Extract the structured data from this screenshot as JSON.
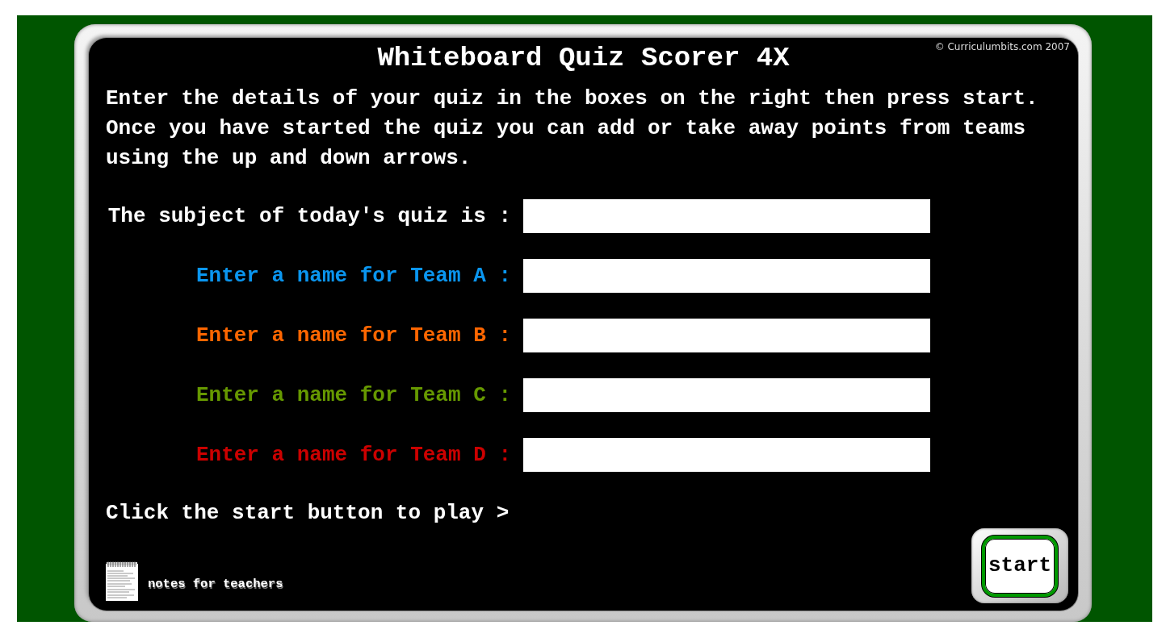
{
  "title": "Whiteboard Quiz Scorer 4X",
  "copyright": "© Curriculumbits.com 2007",
  "instructions": "Enter the details of your quiz in the boxes on the right then press start. Once you have started the quiz you can add or take away points from teams using the up and down arrows.",
  "fields": [
    {
      "label": "The subject of today's quiz is :",
      "color": "#ffffff"
    },
    {
      "label": "Enter a name for Team A :",
      "color": "#0a96f0"
    },
    {
      "label": "Enter a name for Team B :",
      "color": "#ff6600"
    },
    {
      "label": "Enter a name for Team C :",
      "color": "#669900"
    },
    {
      "label": "Enter a name for Team D :",
      "color": "#cc0000"
    }
  ],
  "prompt": "Click the start button to play >",
  "start_button": "start",
  "notes_link": "notes for teachers"
}
